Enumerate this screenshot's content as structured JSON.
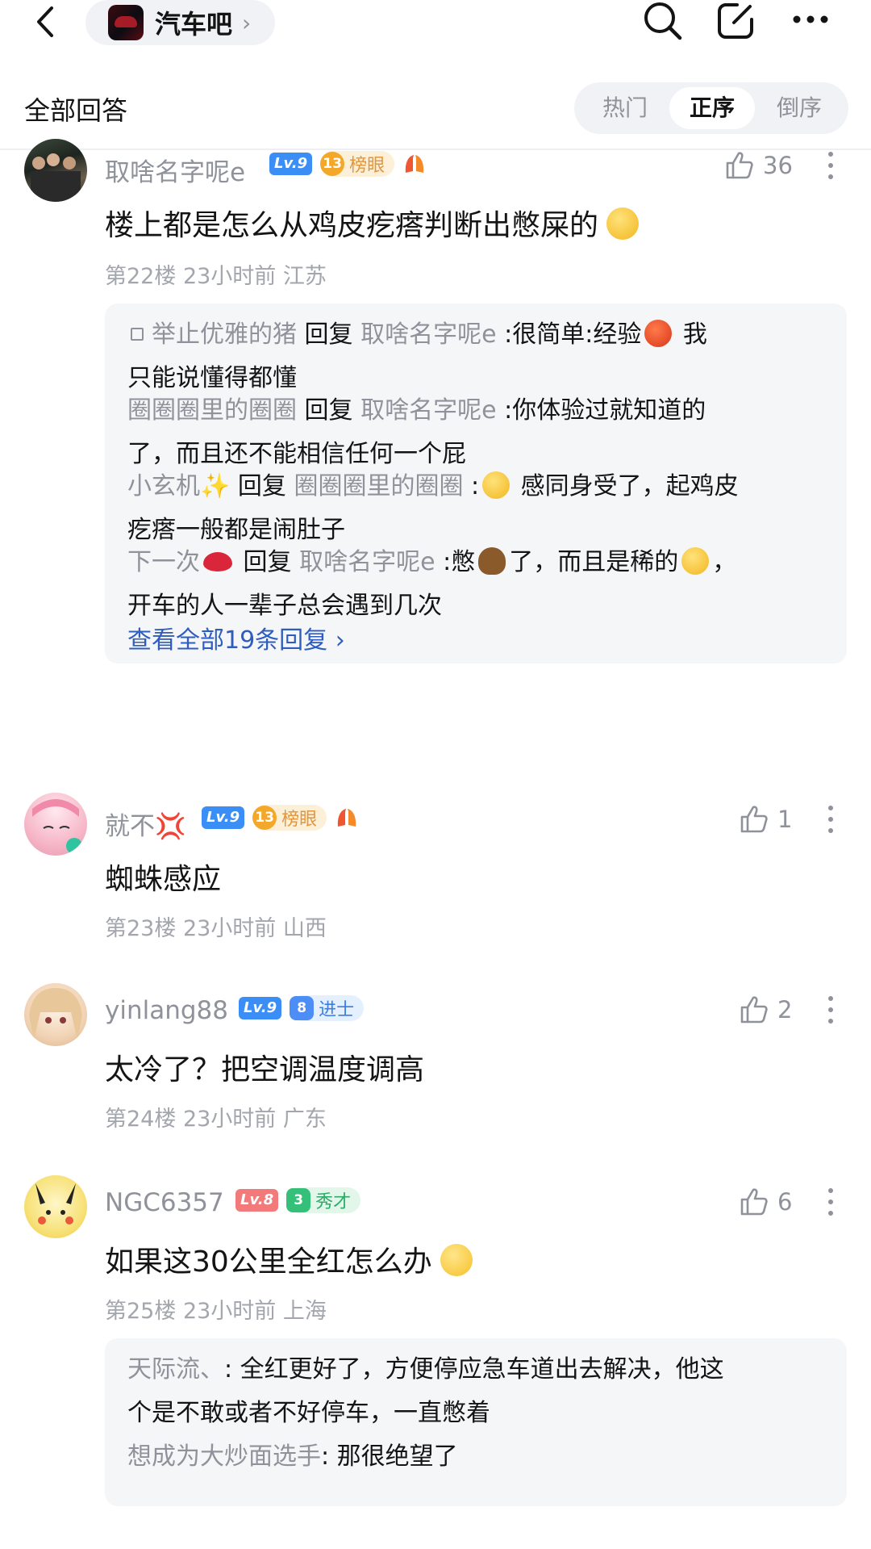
{
  "header": {
    "forum_name": "汽车吧",
    "icons": [
      "back-arrow-icon",
      "search-icon",
      "edit-icon",
      "more-icon"
    ]
  },
  "sortbar": {
    "title": "全部回答",
    "tabs": [
      {
        "label": "热门",
        "active": false
      },
      {
        "label": "正序",
        "active": true
      },
      {
        "label": "倒序",
        "active": false
      }
    ]
  },
  "posts": [
    {
      "username": "取啥名字呢e",
      "level": "Lv.9",
      "rank_num": "13",
      "rank_label": "榜眼",
      "likes": "36",
      "content": "楼上都是怎么从鸡皮疙瘩判断出憋屎的",
      "floor": "第22楼",
      "time": "23小时前",
      "location": "江苏",
      "replies": [
        {
          "user": "举止优雅的猪",
          "verb": "回复",
          "target": "取啥名字呢e",
          "text_a": ":很简单:经验",
          "text_b": " 我",
          "text_line2": "只能说懂得都懂"
        },
        {
          "user": "圈圈圈里的圈圈",
          "verb": "回复",
          "target": "取啥名字呢e",
          "text_a": ":你体验过就知道的",
          "text_line2": "了，而且还不能相信任何一个屁"
        },
        {
          "user": "小玄机",
          "verb": "回复",
          "target": "圈圈圈里的圈圈",
          "text_a": ":",
          "text_b": " 感同身受了，起鸡皮",
          "text_line2": "疙瘩一般都是闹肚子"
        },
        {
          "user": "下一次",
          "verb": "回复",
          "target": "取啥名字呢e",
          "text_a": ":憋",
          "text_b": "了，而且是稀的",
          "text_c": "，",
          "text_line2": "开车的人一辈子总会遇到几次"
        }
      ],
      "view_all": "查看全部19条回复 ›"
    },
    {
      "username": "就不",
      "level": "Lv.9",
      "rank_num": "13",
      "rank_label": "榜眼",
      "likes": "1",
      "content": "蜘蛛感应",
      "floor": "第23楼",
      "time": "23小时前",
      "location": "山西"
    },
    {
      "username": "yinlang88",
      "level": "Lv.9",
      "rank_num": "8",
      "rank_label": "进士",
      "likes": "2",
      "content": "太冷了？把空调温度调高",
      "floor": "第24楼",
      "time": "23小时前",
      "location": "广东"
    },
    {
      "username": "NGC6357",
      "level": "Lv.8",
      "rank_num": "3",
      "rank_label": "秀才",
      "likes": "6",
      "content": "如果这30公里全红怎么办",
      "floor": "第25楼",
      "time": "23小时前",
      "location": "上海",
      "replies": [
        {
          "user": "天际流、",
          "text_a": ": 全红更好了，方便停应急车道出去解决，他这",
          "text_line2": "个是不敢或者不好停车，一直憋着"
        },
        {
          "user": "想成为大炒面选手",
          "text_a": ": 那很绝望了"
        }
      ]
    }
  ],
  "colors": {
    "link": "#2e5dbf",
    "muted": "#8f929a",
    "level_blue": "#3a8ef6",
    "level_red": "#f27a7a"
  }
}
